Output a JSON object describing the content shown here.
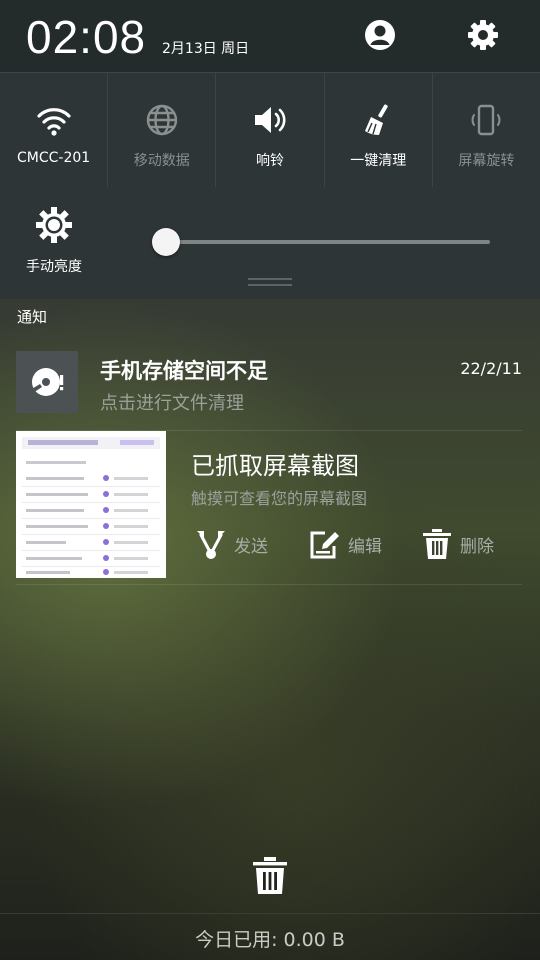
{
  "status": {
    "time": "02:08",
    "date": "2月13日 周日"
  },
  "quick_tiles": [
    {
      "label": "CMCC-201",
      "icon": "wifi-icon",
      "active": true
    },
    {
      "label": "移动数据",
      "icon": "globe-icon",
      "active": false
    },
    {
      "label": "响铃",
      "icon": "speaker-icon",
      "active": true
    },
    {
      "label": "一键清理",
      "icon": "broom-icon",
      "active": true
    },
    {
      "label": "屏幕旋转",
      "icon": "rotate-phone-icon",
      "active": false
    }
  ],
  "brightness": {
    "label": "手动亮度",
    "level": 0.0
  },
  "notifications": {
    "header": "通知",
    "storage": {
      "title": "手机存储空间不足",
      "subtitle": "点击进行文件清理",
      "date": "22/2/11"
    },
    "screenshot": {
      "title": "已抓取屏幕截图",
      "subtitle": "触摸可查看您的屏幕截图",
      "actions": {
        "send": "发送",
        "edit": "编辑",
        "delete": "删除"
      }
    }
  },
  "footer": {
    "usage": "今日已用: 0.00 B"
  },
  "colors": {
    "panel": "#2e3536",
    "status_bar": "#232b2b",
    "accent_purple": "#8e6fd6"
  }
}
